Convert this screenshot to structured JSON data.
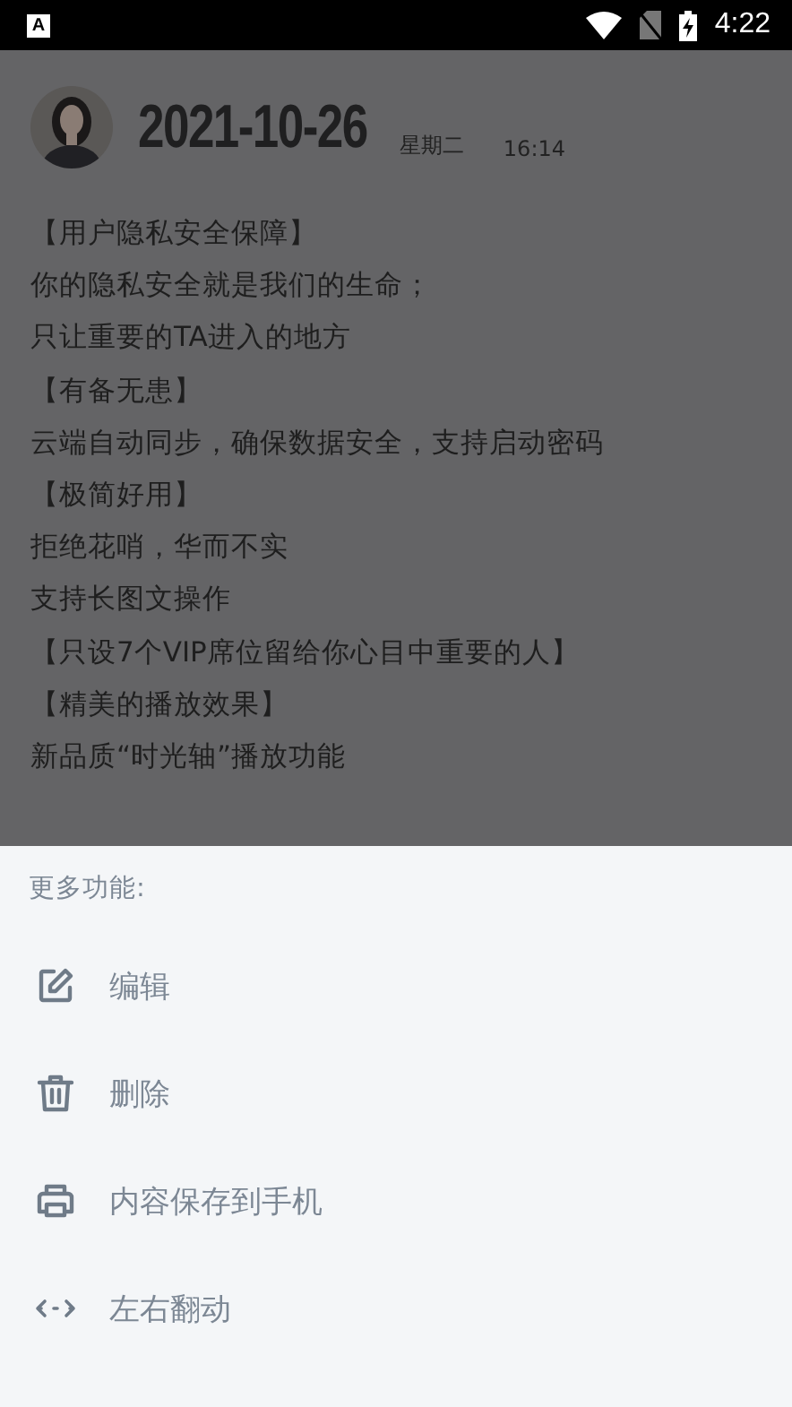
{
  "status_bar": {
    "time": "4:22",
    "app_badge": "A"
  },
  "header": {
    "date": "2021-10-26",
    "weekday": "星期二",
    "time": "16:14"
  },
  "lines": [
    "【用户隐私安全保障】",
    "你的隐私安全就是我们的生命；",
    "只让重要的TA进入的地方",
    "【有备无患】",
    "云端自动同步，确保数据安全，支持启动密码",
    "【极简好用】",
    "拒绝花哨，华而不实",
    "支持长图文操作",
    "【只设7个VIP席位留给你心目中重要的人】",
    "【精美的播放效果】",
    "新品质“时光轴”播放功能"
  ],
  "sheet": {
    "title": "更多功能:",
    "items": [
      {
        "kind": "edit",
        "label": "编辑"
      },
      {
        "kind": "delete",
        "label": "删除"
      },
      {
        "kind": "print",
        "label": "内容保存到手机"
      },
      {
        "kind": "swap",
        "label": "左右翻动"
      }
    ]
  }
}
